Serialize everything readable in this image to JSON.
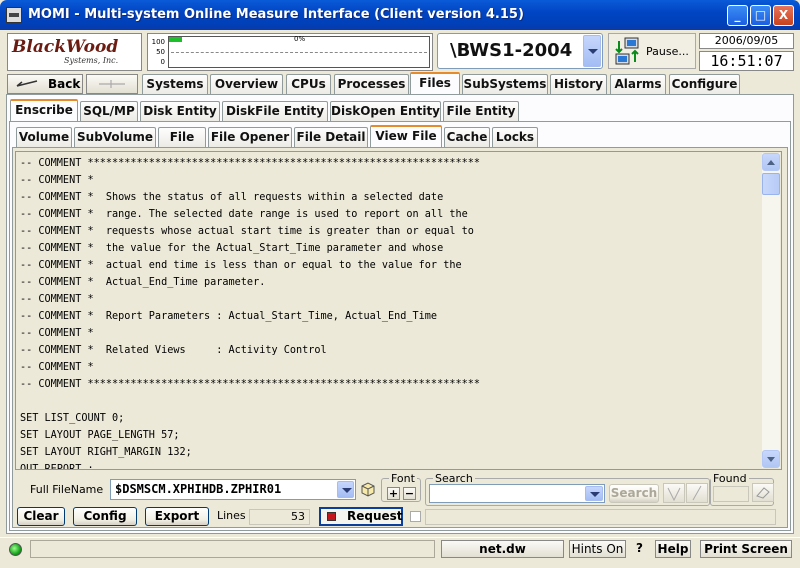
{
  "window": {
    "title": "MOMI - Multi-system Online Measure Interface (Client version 4.15)",
    "minimize_label": "_",
    "maximize_label": "□",
    "close_label": "X"
  },
  "header": {
    "logo_main": "BlackWood",
    "logo_sub": "Systems, Inc.",
    "meter_axis": [
      "100",
      "50",
      "0"
    ],
    "meter_percent_label": "0%",
    "meter_value_percent": 5,
    "node": "\\BWS1-2004",
    "pause_label": "Pause...",
    "date": "2006/09/05",
    "time": "16:51:07"
  },
  "nav": {
    "back_label": "Back",
    "forward_label": ""
  },
  "tabs_main": [
    {
      "label": "Systems",
      "active": false
    },
    {
      "label": "Overview",
      "active": false
    },
    {
      "label": "CPUs",
      "active": false
    },
    {
      "label": "Processes",
      "active": false
    },
    {
      "label": "Files",
      "active": true
    },
    {
      "label": "SubSystems",
      "active": false
    },
    {
      "label": "History",
      "active": false
    },
    {
      "label": "Alarms",
      "active": false
    },
    {
      "label": "Configure",
      "active": false
    }
  ],
  "tabs_files": [
    {
      "label": "Enscribe",
      "active": true
    },
    {
      "label": "SQL/MP",
      "active": false
    },
    {
      "label": "Disk Entity",
      "active": false
    },
    {
      "label": "DiskFile Entity",
      "active": false
    },
    {
      "label": "DiskOpen Entity",
      "active": false
    },
    {
      "label": "File Entity",
      "active": false
    }
  ],
  "tabs_enscribe": [
    {
      "label": "Volume",
      "active": false
    },
    {
      "label": "SubVolume",
      "active": false
    },
    {
      "label": "File",
      "active": false
    },
    {
      "label": "File Opener",
      "active": false
    },
    {
      "label": "File Detail",
      "active": false
    },
    {
      "label": "View File",
      "active": true
    },
    {
      "label": "Cache",
      "active": false
    },
    {
      "label": "Locks",
      "active": false
    }
  ],
  "file_content": [
    "-- COMMENT ****************************************************************",
    "-- COMMENT *",
    "-- COMMENT *  Shows the status of all requests within a selected date",
    "-- COMMENT *  range. The selected date range is used to report on all the",
    "-- COMMENT *  requests whose actual start time is greater than or equal to",
    "-- COMMENT *  the value for the Actual_Start_Time parameter and whose",
    "-- COMMENT *  actual end time is less than or equal to the value for the",
    "-- COMMENT *  Actual_End_Time parameter.",
    "-- COMMENT *",
    "-- COMMENT *  Report Parameters : Actual_Start_Time, Actual_End_Time",
    "-- COMMENT *",
    "-- COMMENT *  Related Views     : Activity Control",
    "-- COMMENT *",
    "-- COMMENT ****************************************************************",
    "",
    "SET LIST_COUNT 0;",
    "SET LAYOUT PAGE_LENGTH 57;",
    "SET LAYOUT RIGHT_MARGIN 132;",
    "OUT_REPORT ;"
  ],
  "controls": {
    "full_filename_label": "Full FileName",
    "full_filename_value": "$DSMSCM.XPHIHDB.ZPHIR01",
    "font_label": "Font",
    "font_plus": "+",
    "font_minus": "−",
    "search_label": "Search",
    "search_value": "",
    "search_button": "Search",
    "found_label": "Found",
    "clear_label": "Clear",
    "config_label": "Config",
    "export_label": "Export",
    "lines_label": "Lines",
    "lines_value": "53",
    "request_label": "Request"
  },
  "statusbar": {
    "server": "net.dw",
    "hints": "Hints On",
    "question": "?",
    "help": "Help",
    "print": "Print Screen"
  }
}
